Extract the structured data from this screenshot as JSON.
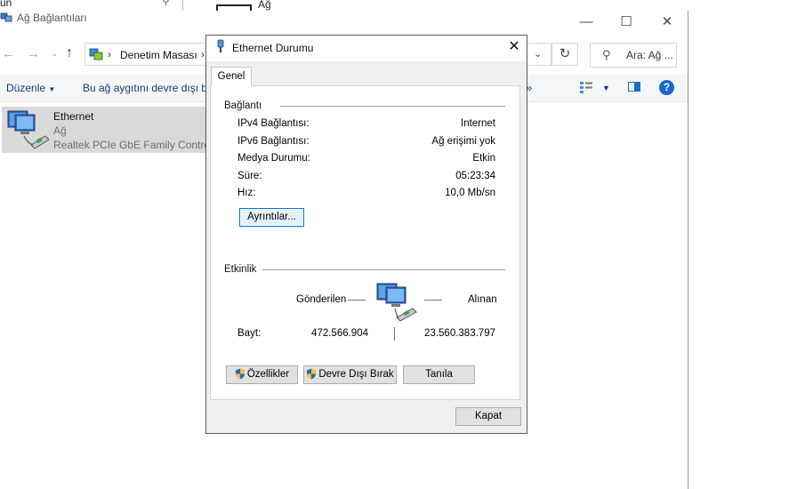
{
  "background": {
    "top_strip_text": "ün",
    "top_right_text": "Ağ",
    "window_title": "Ağ Bağlantıları",
    "address": {
      "path": "Denetim Masası"
    },
    "search_placeholder": "Ara: Ağ ...",
    "toolbar": {
      "organize": "Düzenle",
      "disable_device": "Bu ağ aygıtını devre dışı bı"
    },
    "connection": {
      "name": "Ethernet",
      "status": "Ağ",
      "device": "Realtek PCIe GbE Family Control"
    }
  },
  "dialog": {
    "title": "Ethernet Durumu",
    "tab": "Genel",
    "connection_group": "Bağlantı",
    "rows": [
      {
        "label": "IPv4 Bağlantısı:",
        "value": "Internet"
      },
      {
        "label": "IPv6 Bağlantısı:",
        "value": "Ağ erişimi yok"
      },
      {
        "label": "Medya Durumu:",
        "value": "Etkin"
      },
      {
        "label": "Süre:",
        "value": "05:23:34"
      },
      {
        "label": "Hız:",
        "value": "10,0 Mb/sn"
      }
    ],
    "details_button": "Ayrıntılar...",
    "activity_group": "Etkinlik",
    "sent_label": "Gönderilen",
    "received_label": "Alınan",
    "bytes_label": "Bayt:",
    "bytes_sent": "472.566.904",
    "bytes_received": "23.560.383.797",
    "properties_button": "Özellikler",
    "disable_button": "Devre Dışı Bırak",
    "diagnose_button": "Tanıla",
    "close_button": "Kapat"
  },
  "colors": {
    "accent": "#0078d7",
    "help": "#1a66c9",
    "selection": "#d9d9d9",
    "dialog_bg": "#f0f0f0"
  },
  "icons": [
    "search-icon",
    "network-icon",
    "shield-icon",
    "help-icon",
    "close-icon",
    "refresh-icon"
  ]
}
